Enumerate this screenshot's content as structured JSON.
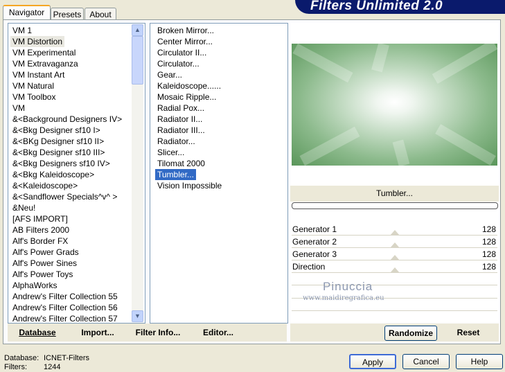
{
  "banner": {
    "title": "Filters Unlimited 2.0"
  },
  "tabs": [
    {
      "label": "Navigator",
      "active": true
    },
    {
      "label": "Presets",
      "active": false
    },
    {
      "label": "About",
      "active": false
    }
  ],
  "categories": [
    "VM 1",
    "VM Distortion",
    "VM Experimental",
    "VM Extravaganza",
    "VM Instant Art",
    "VM Natural",
    "VM Toolbox",
    "VM",
    "&<Background Designers IV>",
    "&<Bkg Designer sf10 I>",
    "&<BKg Designer sf10 II>",
    "&<Bkg Designer sf10 III>",
    "&<Bkg Designers sf10 IV>",
    "&<Bkg Kaleidoscope>",
    "&<Kaleidoscope>",
    "&<Sandflower Specials^v^ >",
    "&Neu!",
    "[AFS IMPORT]",
    "AB Filters 2000",
    "Alf's Border FX",
    "Alf's Power Grads",
    "Alf's Power Sines",
    "Alf's Power Toys",
    "AlphaWorks",
    "Andrew's Filter Collection 55",
    "Andrew's Filter Collection 56",
    "Andrew's Filter Collection 57"
  ],
  "selected_category": "VM Distortion",
  "filters": [
    "Broken Mirror...",
    "Center Mirror...",
    "Circulator II...",
    "Circulator...",
    "Gear...",
    "Kaleidoscope......",
    "Mosaic Ripple...",
    "Radial Pox...",
    "Radiator II...",
    "Radiator III...",
    "Radiator...",
    "Slicer...",
    "Tilomat 2000",
    "Tumbler...",
    "Vision Impossible"
  ],
  "selected_filter": "Tumbler...",
  "left_buttons": {
    "database": "Database",
    "import": "Import...",
    "filter_info": "Filter Info...",
    "editor": "Editor..."
  },
  "preview": {
    "filter_name": "Tumbler..."
  },
  "params": [
    {
      "label": "Generator 1",
      "value": "128",
      "level": 0.5
    },
    {
      "label": "Generator 2",
      "value": "128",
      "level": 0.5
    },
    {
      "label": "Generator 3",
      "value": "128",
      "level": 0.5
    },
    {
      "label": "Direction",
      "value": "128",
      "level": 0.5
    }
  ],
  "watermark": {
    "name": "Pinuccia",
    "url": "www.maidiregrafica.eu"
  },
  "right_buttons": {
    "randomize": "Randomize",
    "reset": "Reset"
  },
  "status": {
    "database_label": "Database:",
    "database_value": "ICNET-Filters",
    "filters_label": "Filters:",
    "filters_value": "1244"
  },
  "dialog_buttons": {
    "apply": "Apply",
    "cancel": "Cancel",
    "help": "Help"
  },
  "colors": {
    "selection": "#316ac5",
    "banner": "#0a1a6c",
    "preview_green": "#5a965a"
  }
}
